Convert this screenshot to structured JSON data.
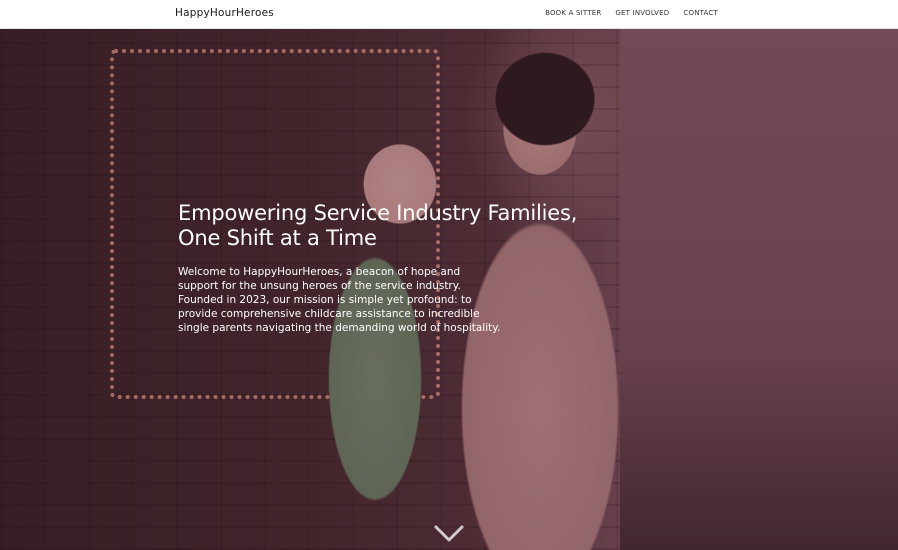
{
  "header": {
    "logo": "HappyHourHeroes",
    "nav": [
      {
        "label": "BOOK A SITTER"
      },
      {
        "label": "GET INVOLVED"
      },
      {
        "label": "CONTACT"
      }
    ]
  },
  "hero": {
    "title_line1": "Empowering Service Industry Families,",
    "title_line2": "One Shift at a Time",
    "body": "Welcome to HappyHourHeroes, a beacon of hope and support for the unsung heroes of the service industry. Founded in 2023, our mission is simple yet profound: to provide comprehensive childcare assistance to incredible single parents navigating the demanding world of hospitality.",
    "scroll_icon": "chevron-down-icon",
    "overlay_color": "#5a2837"
  }
}
